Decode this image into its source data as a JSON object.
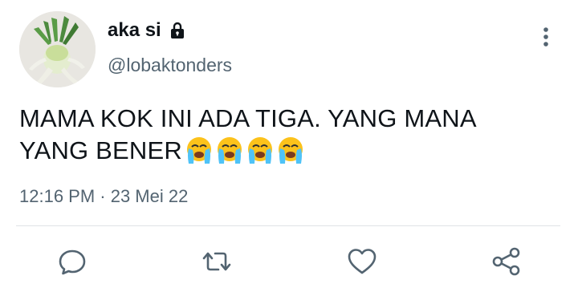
{
  "tweet": {
    "author": {
      "display_name": "aka si",
      "handle": "@lobaktonders",
      "avatar_icon": "radish-avatar",
      "protected_icon": "lock-icon"
    },
    "text_line_1": "MAMA KOK INI ADA TIGA. YANG MANA",
    "text_line_2": "YANG BENER",
    "emojis": [
      "loudly-crying-face-emoji",
      "loudly-crying-face-emoji",
      "loudly-crying-face-emoji",
      "loudly-crying-face-emoji"
    ],
    "timestamp": "12:16 PM · 23 Mei 22"
  },
  "actions": {
    "more_icon": "more-vertical-icon",
    "reply_icon": "reply-icon",
    "retweet_icon": "retweet-icon",
    "like_icon": "heart-icon",
    "share_icon": "share-icon"
  },
  "colors": {
    "text_primary": "#0f1419",
    "text_secondary": "#536471",
    "divider": "#dfe3e6"
  }
}
